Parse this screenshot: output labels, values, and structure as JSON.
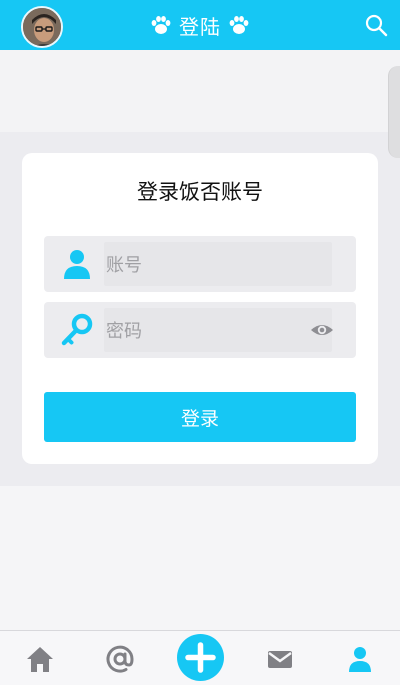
{
  "header": {
    "title": "登陆",
    "avatar_icon": "avatar",
    "search_icon": "search-icon"
  },
  "login": {
    "heading": "登录饭否账号",
    "account_placeholder": "账号",
    "password_placeholder": "密码",
    "submit_label": "登录"
  },
  "nav": {
    "items": [
      "home-icon",
      "at-icon",
      "add-icon",
      "mail-icon",
      "profile-icon"
    ]
  },
  "colors": {
    "accent": "#16c7f4",
    "nav_grey": "#808085"
  }
}
